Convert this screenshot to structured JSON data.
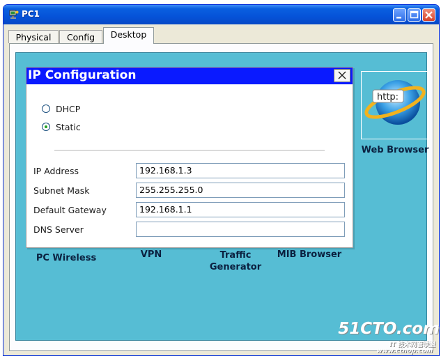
{
  "window": {
    "title": "PC1"
  },
  "tabs": [
    {
      "label": "Physical",
      "active": false
    },
    {
      "label": "Config",
      "active": false
    },
    {
      "label": "Desktop",
      "active": true
    }
  ],
  "dialog": {
    "title": "IP Configuration",
    "options": [
      {
        "label": "DHCP",
        "selected": false
      },
      {
        "label": "Static",
        "selected": true
      }
    ],
    "fields": [
      {
        "label": "IP Address",
        "value": "192.168.1.3"
      },
      {
        "label": "Subnet Mask",
        "value": "255.255.255.0"
      },
      {
        "label": "Default Gateway",
        "value": "192.168.1.1"
      },
      {
        "label": "DNS Server",
        "value": ""
      }
    ]
  },
  "desktop": {
    "web_browser_icon_text": "http:",
    "web_browser_label": "Web Browser",
    "pc_wireless_label": "PC Wireless",
    "vpn_label": "VPN",
    "traffic_generator_label_line1": "Traffic",
    "traffic_generator_label_line2": "Generator",
    "mib_browser_label": "MIB Browser"
  },
  "watermark": {
    "logo": "51CTO.com",
    "tagline": "IT 技术网管联盟",
    "url": "www.ctnop.com"
  },
  "colors": {
    "desktop_background": "#56bdd4",
    "dialog_title_bar": "#0a1aff",
    "titlebar": "#0553d8"
  }
}
